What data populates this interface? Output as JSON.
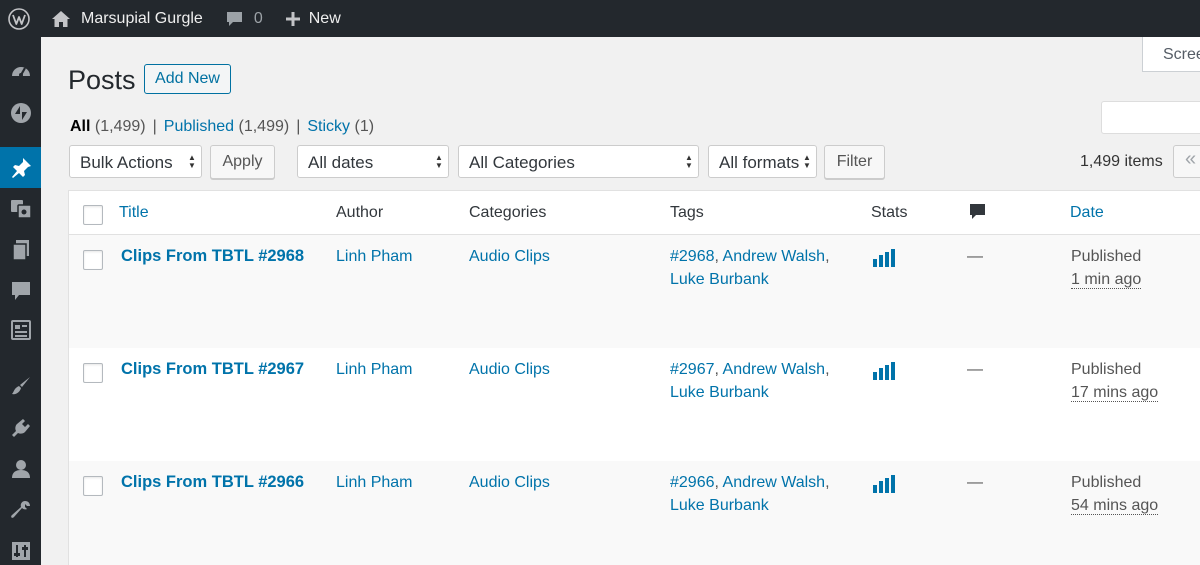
{
  "admin_bar": {
    "site_name": "Marsupial Gurgle",
    "comments_count": "0",
    "new_label": "New"
  },
  "page": {
    "title": "Posts",
    "add_new_label": "Add New",
    "screen_options_label": "Screen Options",
    "search_value": ""
  },
  "filters": {
    "all_label": "All",
    "all_count": "(1,499)",
    "published_label": "Published",
    "published_count": "(1,499)",
    "sticky_label": "Sticky",
    "sticky_count": "(1)",
    "separator": "|"
  },
  "tablenav": {
    "bulk_actions": "Bulk Actions",
    "apply_label": "Apply",
    "dates": "All dates",
    "categories": "All Categories",
    "formats": "All formats",
    "filter_label": "Filter",
    "items_count": "1,499 items",
    "first_page_glyph": "«"
  },
  "table": {
    "columns": {
      "title": "Title",
      "author": "Author",
      "categories": "Categories",
      "tags": "Tags",
      "stats": "Stats",
      "comments_icon": "comment-bubble-icon",
      "date": "Date"
    },
    "rows": [
      {
        "title": "Clips From TBTL #2968",
        "author": "Linh Pham",
        "category": "Audio Clips",
        "tag_1": "#2968",
        "tag_2": "Andrew Walsh",
        "tag_3": "Luke Burbank",
        "comments": "—",
        "status": "Published",
        "time": "1 min ago"
      },
      {
        "title": "Clips From TBTL #2967",
        "author": "Linh Pham",
        "category": "Audio Clips",
        "tag_1": "#2967",
        "tag_2": "Andrew Walsh",
        "tag_3": "Luke Burbank",
        "comments": "—",
        "status": "Published",
        "time": "17 mins ago"
      },
      {
        "title": "Clips From TBTL #2966",
        "author": "Linh Pham",
        "category": "Audio Clips",
        "tag_1": "#2966",
        "tag_2": "Andrew Walsh",
        "tag_3": "Luke Burbank",
        "comments": "—",
        "status": "Published",
        "time": "54 mins ago"
      }
    ]
  },
  "colors": {
    "admin_bar": "#23282d",
    "accent": "#0073aa"
  }
}
